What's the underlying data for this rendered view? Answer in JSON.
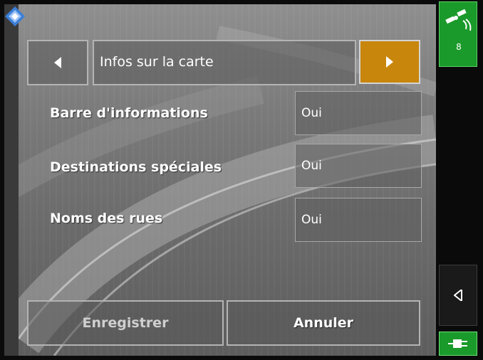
{
  "header": {
    "title": "Infos sur la carte",
    "prev_icon": "triangle-left-icon",
    "next_icon": "triangle-right-icon"
  },
  "settings": [
    {
      "label": "Barre d'informations",
      "value": "Oui"
    },
    {
      "label": "Destinations spéciales",
      "value": "Oui"
    },
    {
      "label": "Noms des rues",
      "value": "Oui"
    }
  ],
  "footer": {
    "save_label": "Enregistrer",
    "cancel_label": "Annuler"
  },
  "status": {
    "satellite_count": "8",
    "gps_icon": "satellite-icon",
    "back_icon": "triangle-left-icon",
    "power_icon": "power-plug-icon"
  },
  "colors": {
    "accent_orange": "#c8860c",
    "status_green": "#1a9a2a"
  }
}
